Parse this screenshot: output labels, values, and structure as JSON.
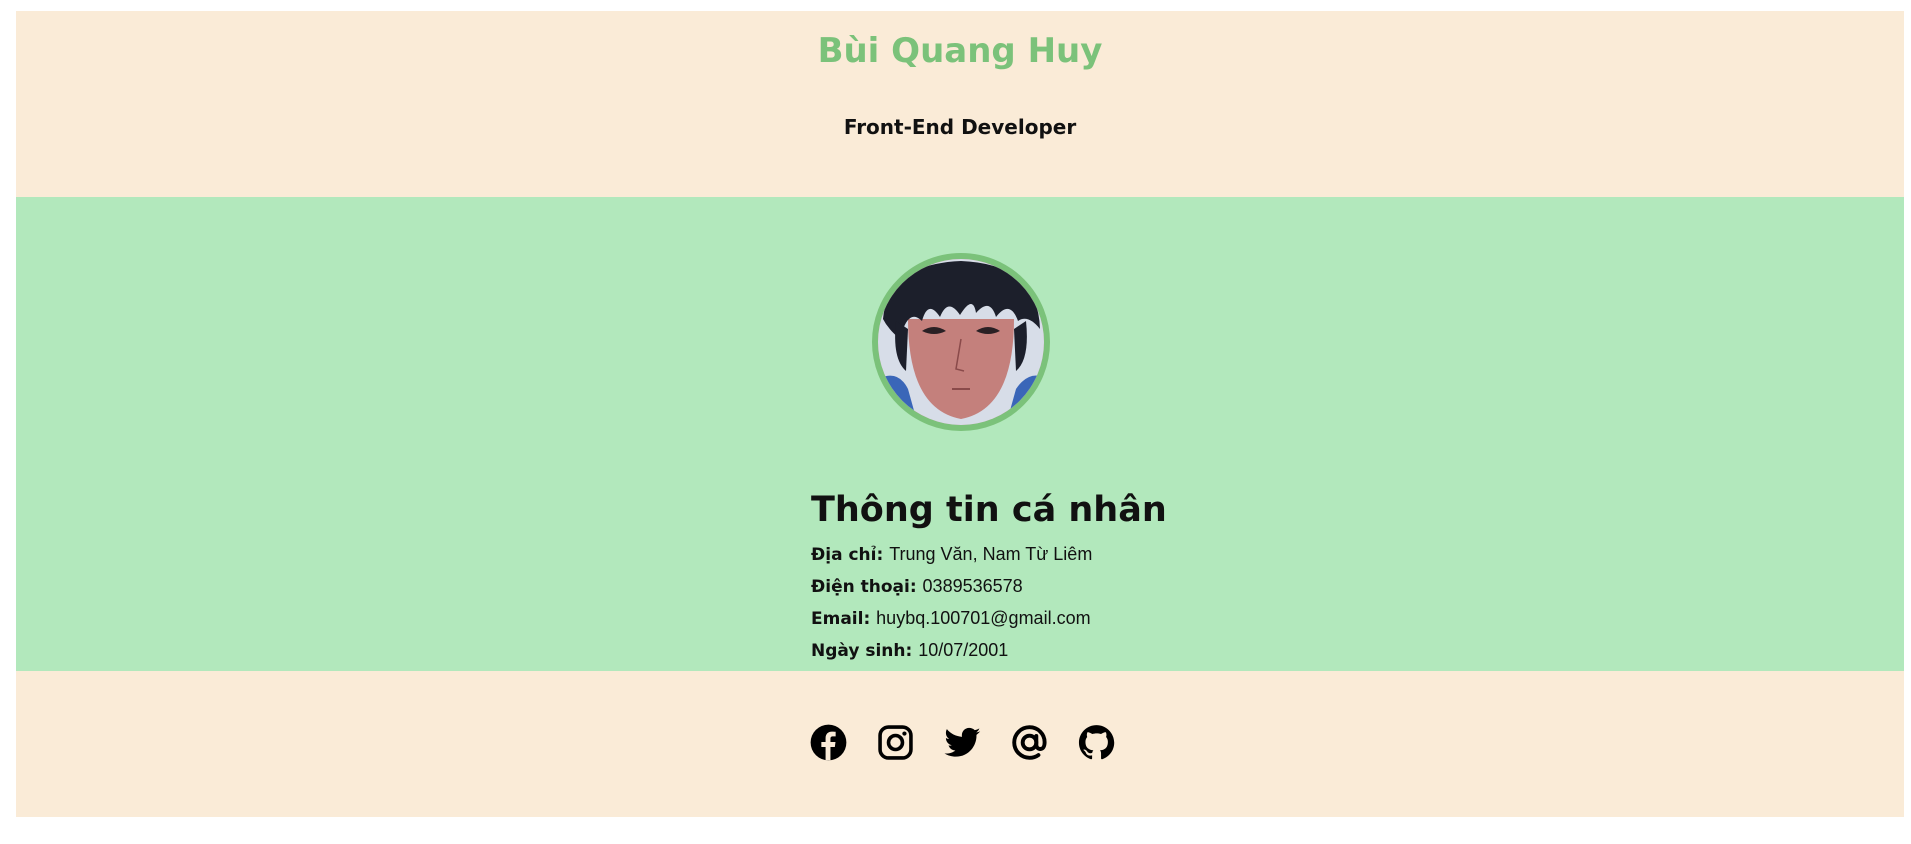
{
  "header": {
    "name": "Bùi Quang Huy",
    "role": "Front-End Developer"
  },
  "profile": {
    "avatar_icon": "avatar-portrait",
    "section_title": "Thông tin cá nhân",
    "fields": [
      {
        "label": "Địa chỉ:",
        "value": "Trung Văn, Nam Từ Liêm"
      },
      {
        "label": "Điện thoại:",
        "value": "0389536578"
      },
      {
        "label": "Email:",
        "value": "huybq.100701@gmail.com"
      },
      {
        "label": "Ngày sinh:",
        "value": "10/07/2001"
      }
    ]
  },
  "footer": {
    "socials": [
      {
        "icon": "facebook-icon"
      },
      {
        "icon": "instagram-icon"
      },
      {
        "icon": "twitter-icon"
      },
      {
        "icon": "at-sign-icon"
      },
      {
        "icon": "github-icon"
      }
    ]
  },
  "colors": {
    "header_bg": "#faebd7",
    "main_bg": "#b2e8bc",
    "accent": "#7bc27a",
    "text": "#111111"
  }
}
